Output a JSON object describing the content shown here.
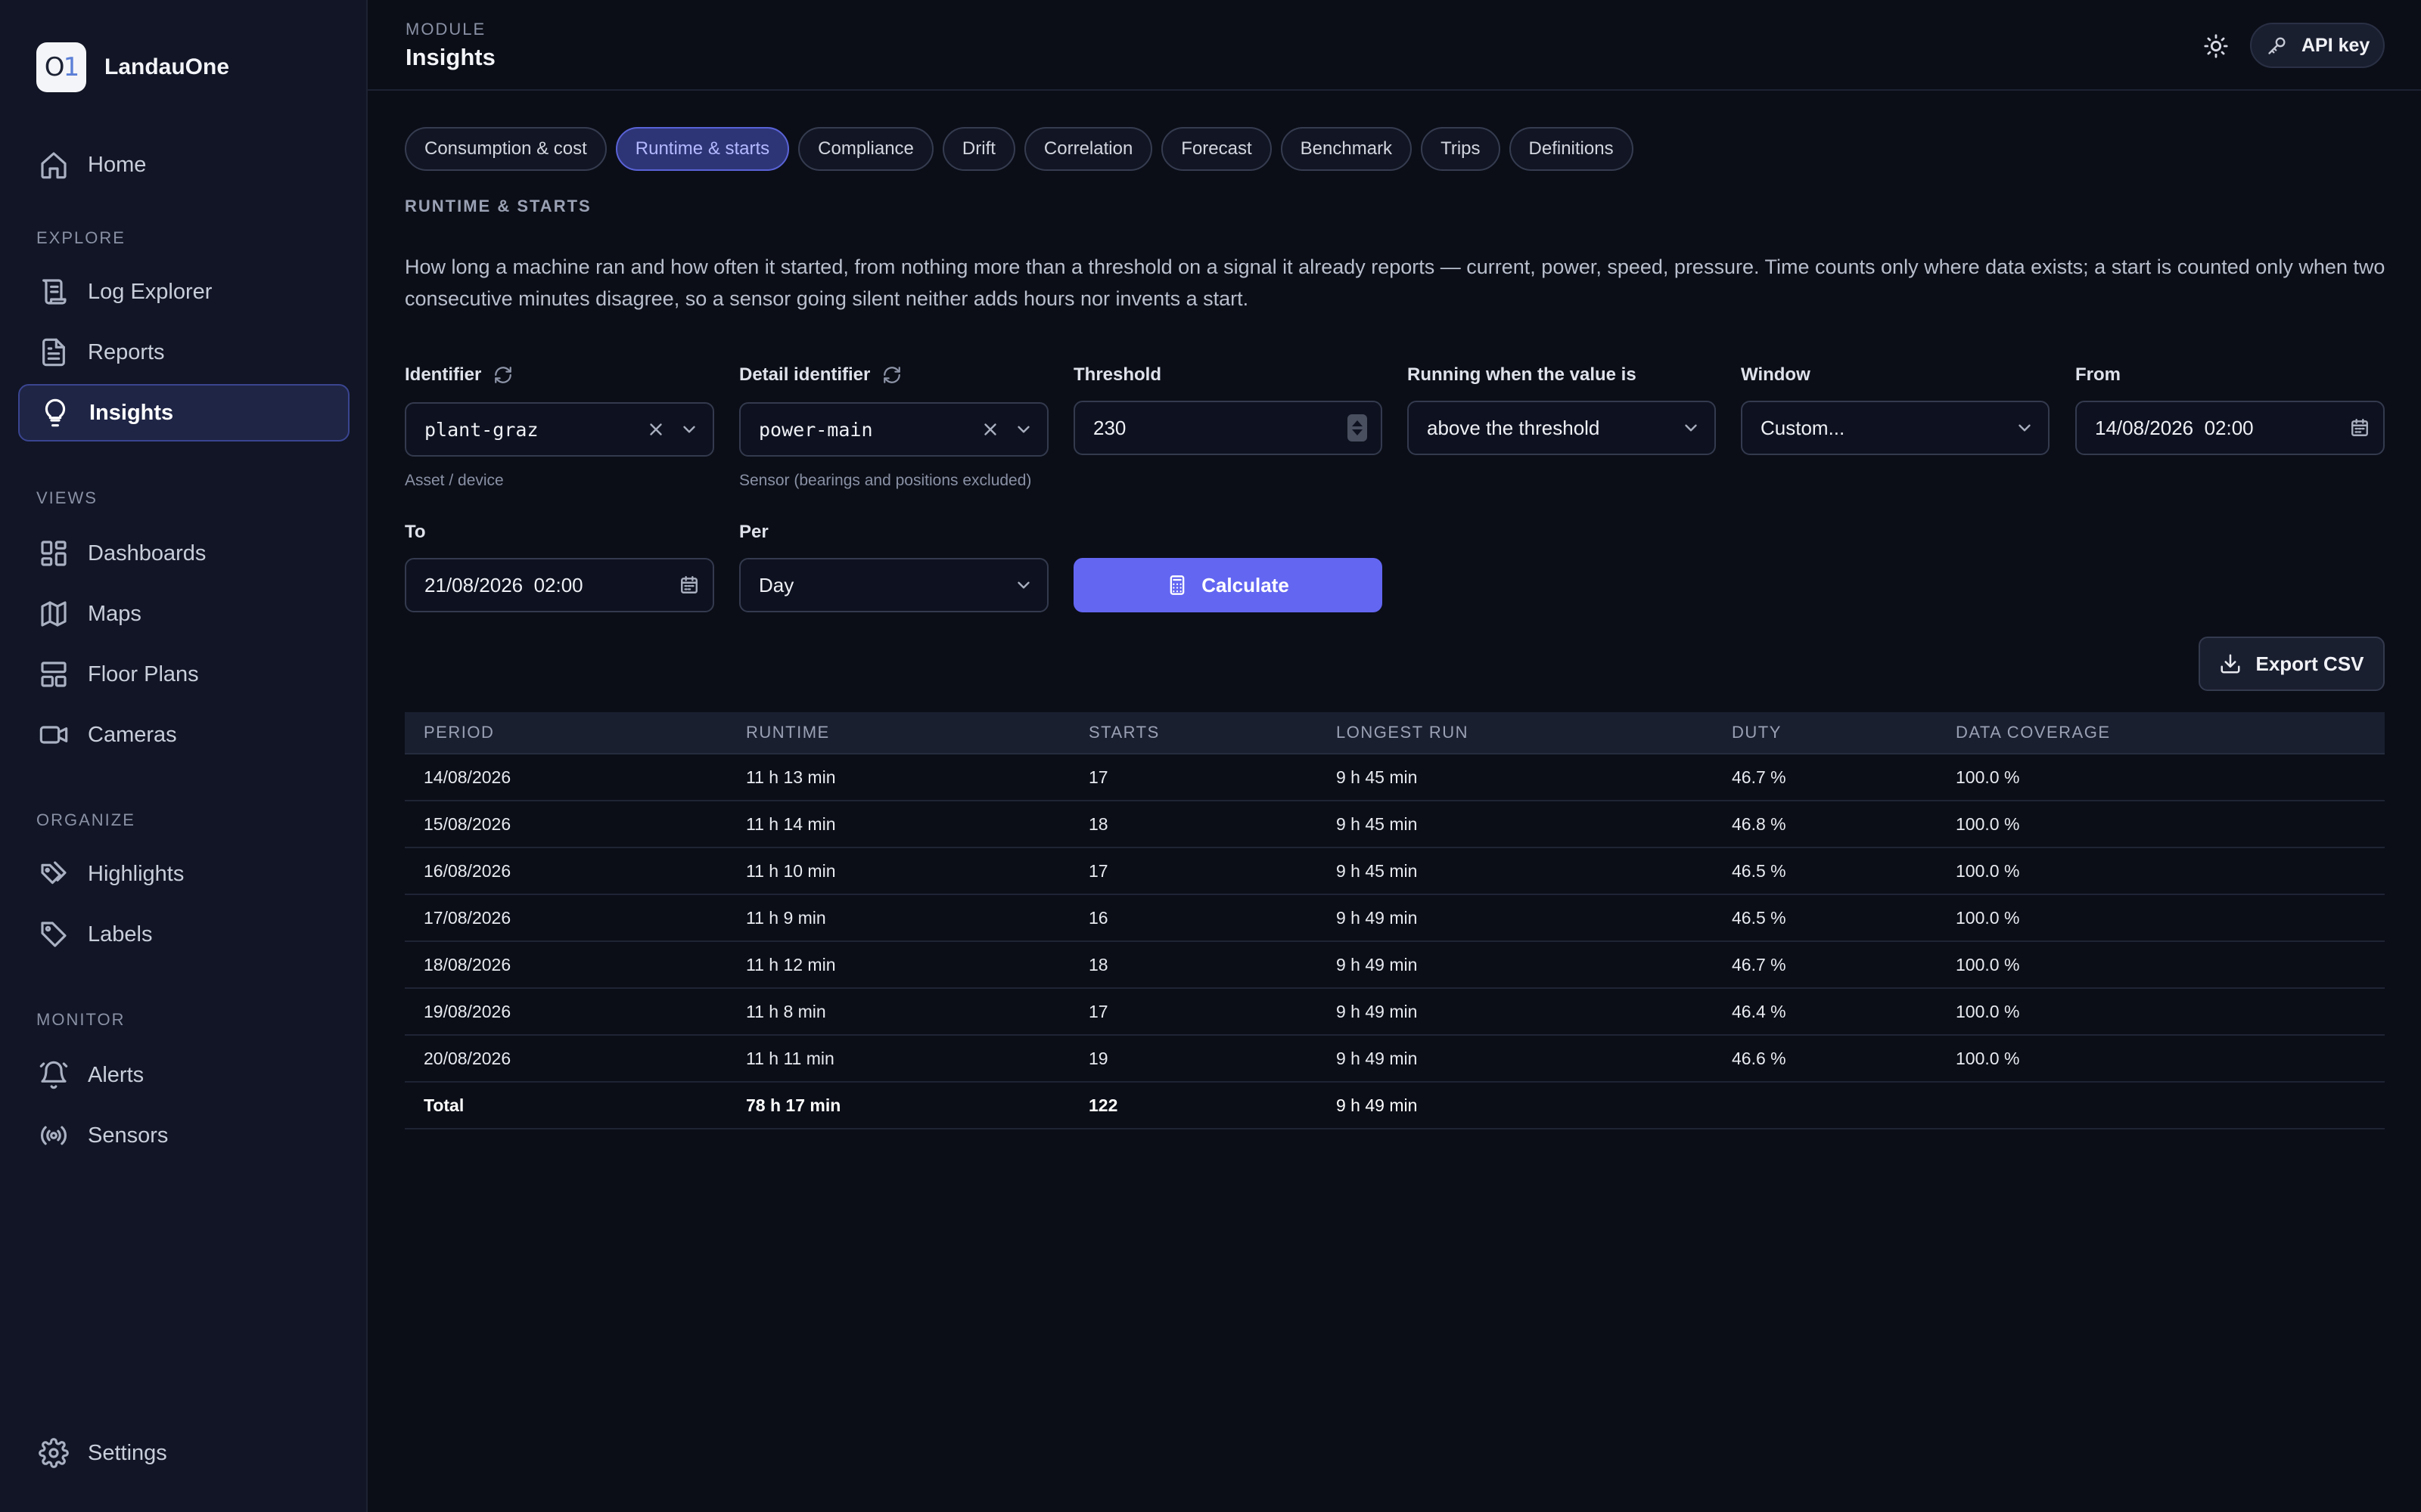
{
  "app": {
    "name": "LandauOne",
    "logo_text": "O",
    "logo_accent": "1"
  },
  "sidebar": {
    "home": "Home",
    "sections": {
      "explore": "EXPLORE",
      "views": "VIEWS",
      "organize": "ORGANIZE",
      "monitor": "MONITOR"
    },
    "items": {
      "log_explorer": "Log Explorer",
      "reports": "Reports",
      "insights": "Insights",
      "dashboards": "Dashboards",
      "maps": "Maps",
      "floor_plans": "Floor Plans",
      "cameras": "Cameras",
      "highlights": "Highlights",
      "labels": "Labels",
      "alerts": "Alerts",
      "sensors": "Sensors",
      "settings": "Settings"
    },
    "active": "insights"
  },
  "header": {
    "module_label": "MODULE",
    "title": "Insights",
    "api_key": "API key"
  },
  "tabs": [
    "Consumption & cost",
    "Runtime & starts",
    "Compliance",
    "Drift",
    "Correlation",
    "Forecast",
    "Benchmark",
    "Trips",
    "Definitions"
  ],
  "active_tab": "Runtime & starts",
  "section": {
    "title": "RUNTIME & STARTS",
    "description": "How long a machine ran and how often it started, from nothing more than a threshold on a signal it already reports — current, power, speed, pressure. Time counts only where data exists; a start is counted only when two consecutive minutes disagree, so a sensor going silent neither adds hours nor invents a start."
  },
  "form": {
    "identifier": {
      "label": "Identifier",
      "value": "plant-graz",
      "helper": "Asset / device"
    },
    "detail_identifier": {
      "label": "Detail identifier",
      "value": "power-main",
      "helper": "Sensor (bearings and positions excluded)"
    },
    "threshold": {
      "label": "Threshold",
      "value": "230"
    },
    "running_when": {
      "label": "Running when the value is",
      "value": "above the threshold"
    },
    "window": {
      "label": "Window",
      "value": "Custom..."
    },
    "from": {
      "label": "From",
      "value": "14/08/2026  02:00"
    },
    "to": {
      "label": "To",
      "value": "21/08/2026  02:00"
    },
    "per": {
      "label": "Per",
      "value": "Day"
    },
    "calculate": "Calculate",
    "export": "Export CSV"
  },
  "table": {
    "headers": [
      "PERIOD",
      "RUNTIME",
      "STARTS",
      "LONGEST RUN",
      "DUTY",
      "DATA COVERAGE"
    ],
    "rows": [
      [
        "14/08/2026",
        "11 h 13 min",
        "17",
        "9 h 45 min",
        "46.7 %",
        "100.0 %"
      ],
      [
        "15/08/2026",
        "11 h 14 min",
        "18",
        "9 h 45 min",
        "46.8 %",
        "100.0 %"
      ],
      [
        "16/08/2026",
        "11 h 10 min",
        "17",
        "9 h 45 min",
        "46.5 %",
        "100.0 %"
      ],
      [
        "17/08/2026",
        "11 h 9 min",
        "16",
        "9 h 49 min",
        "46.5 %",
        "100.0 %"
      ],
      [
        "18/08/2026",
        "11 h 12 min",
        "18",
        "9 h 49 min",
        "46.7 %",
        "100.0 %"
      ],
      [
        "19/08/2026",
        "11 h 8 min",
        "17",
        "9 h 49 min",
        "46.4 %",
        "100.0 %"
      ],
      [
        "20/08/2026",
        "11 h 11 min",
        "19",
        "9 h 49 min",
        "46.6 %",
        "100.0 %"
      ]
    ],
    "total": [
      "Total",
      "78 h 17 min",
      "122",
      "9 h 49 min",
      "",
      ""
    ]
  },
  "colors": {
    "accent": "#6366f1",
    "background": "#0b0e17",
    "sidebar": "#111525",
    "active_nav": "#1f2545"
  }
}
